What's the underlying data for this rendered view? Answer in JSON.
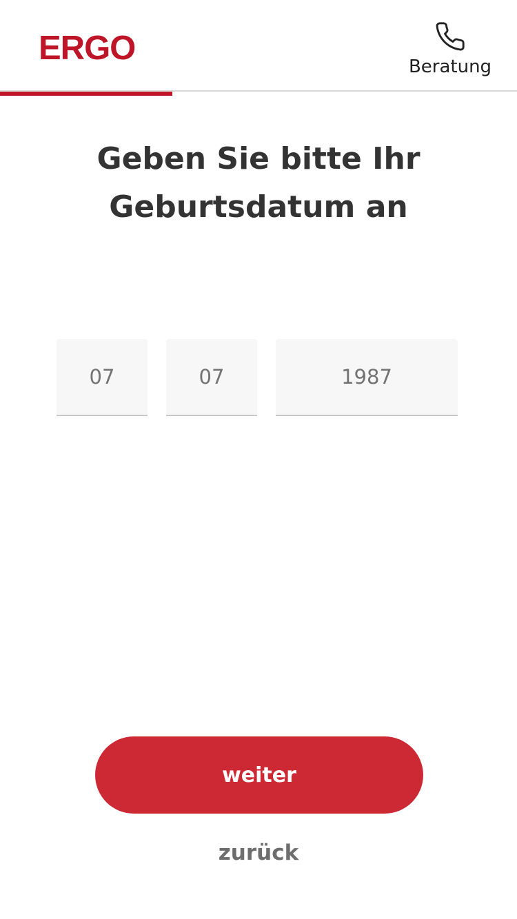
{
  "header": {
    "logo_text": "ERGO",
    "consult_label": "Beratung",
    "consult_icon": "phone-icon",
    "brand_color": "#bf1528"
  },
  "progress": {
    "fraction": 0.333
  },
  "headline": "Geben Sie bitte Ihr Geburtsdatum an",
  "birthdate": {
    "day": "07",
    "month": "07",
    "year": "1987"
  },
  "actions": {
    "next_label": "weiter",
    "back_label": "zurück",
    "next_color": "#cc2935"
  }
}
